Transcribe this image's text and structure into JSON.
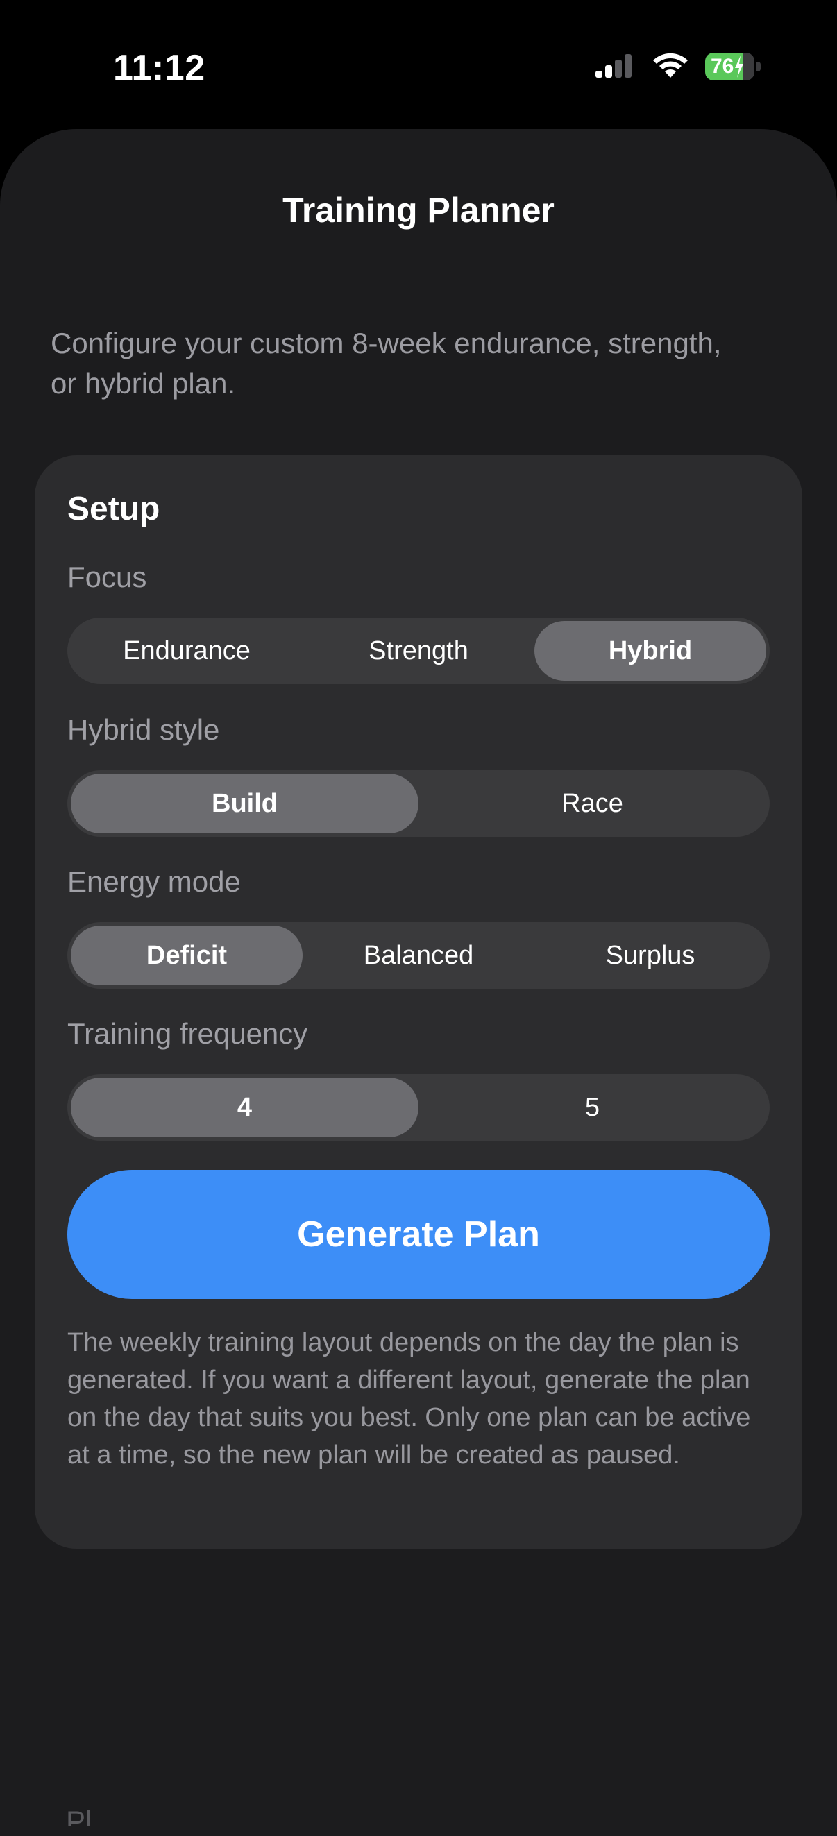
{
  "status_bar": {
    "time": "11:12",
    "battery_level": "76",
    "battery_fill_percent": 76,
    "battery_color": "#5ac85a"
  },
  "header": {
    "title": "Training Planner"
  },
  "intro": "Configure your custom 8-week endurance, strength, or hybrid plan.",
  "setup": {
    "title": "Setup",
    "focus": {
      "label": "Focus",
      "options": [
        "Endurance",
        "Strength",
        "Hybrid"
      ],
      "selected": "Hybrid"
    },
    "hybrid_style": {
      "label": "Hybrid style",
      "options": [
        "Build",
        "Race"
      ],
      "selected": "Build"
    },
    "energy_mode": {
      "label": "Energy mode",
      "options": [
        "Deficit",
        "Balanced",
        "Surplus"
      ],
      "selected": "Deficit"
    },
    "training_frequency": {
      "label": "Training frequency",
      "options": [
        "4",
        "5"
      ],
      "selected": "4"
    },
    "generate_label": "Generate Plan",
    "note": "The weekly training layout depends on the day the plan is generated. If you want a different layout, generate the plan on the day that suits you best. Only one plan can be active at a time, so the new plan will be created as paused."
  },
  "colors": {
    "accent": "#3d8ef7",
    "sheet_background": "#1c1c1e",
    "card_background": "#2c2c2e",
    "segment_selected": "#6c6c70"
  },
  "icons": {
    "signal": "cellular-signal-icon",
    "wifi": "wifi-icon",
    "battery": "battery-charging-icon"
  },
  "partial_text": "Pl"
}
